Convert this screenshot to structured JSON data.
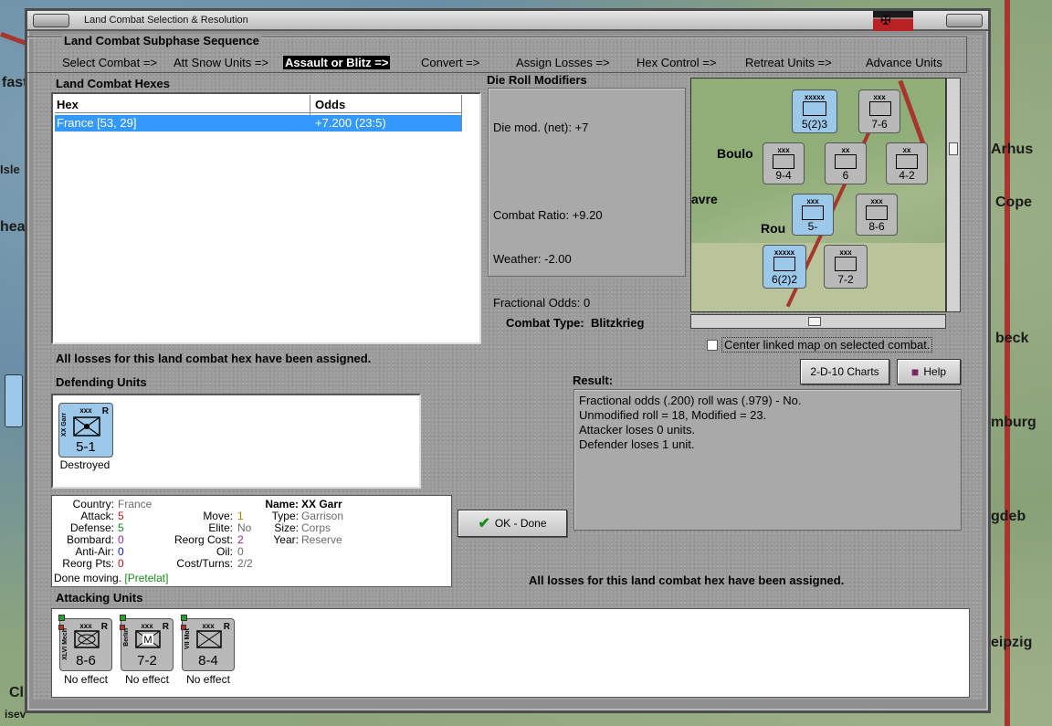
{
  "window": {
    "title": "Land Combat Selection & Resolution"
  },
  "background_map": {
    "labels": [
      "fast",
      "Isle",
      "hea",
      "Arhus",
      "Cope",
      "beck",
      "mburg",
      "gdeb",
      "eipzig",
      "Cl",
      "isev"
    ]
  },
  "subphase": {
    "title": "Land Combat Subphase Sequence",
    "steps": [
      {
        "label": "Select Combat =>",
        "active": false
      },
      {
        "label": "Att Snow Units =>",
        "active": false
      },
      {
        "label": "Assault or Blitz =>",
        "active": true
      },
      {
        "label": "Convert =>",
        "active": false
      },
      {
        "label": "Assign Losses =>",
        "active": false
      },
      {
        "label": "Hex Control =>",
        "active": false
      },
      {
        "label": "Retreat Units =>",
        "active": false
      },
      {
        "label": "Advance Units",
        "active": false
      }
    ]
  },
  "combat_hexes": {
    "title": "Land Combat Hexes",
    "columns": [
      "Hex",
      "Odds"
    ],
    "rows": [
      {
        "hex": "France [53, 29]",
        "odds": "+7.200 (23:5)",
        "selected": true
      }
    ],
    "status": "All losses for this land combat hex have been assigned."
  },
  "die_roll": {
    "title": "Die Roll Modifiers",
    "lines": [
      "Die mod. (net): +7",
      "",
      "Combat Ratio: +9.20",
      "Weather: -2.00",
      "Fractional Odds: 0"
    ]
  },
  "combat_type": {
    "label": "Combat Type:",
    "value": "Blitzkrieg"
  },
  "minimap": {
    "labels": [
      "Boulo",
      "avre",
      "Rou"
    ],
    "counters": [
      {
        "top": "xxxxx",
        "str": "5(2)3",
        "color": "blue"
      },
      {
        "top": "xxx",
        "str": "7-6",
        "color": "grey"
      },
      {
        "top": "xxx",
        "str": "9-4",
        "color": "grey"
      },
      {
        "top": "xx",
        "str": "6",
        "color": "grey"
      },
      {
        "top": "xx",
        "str": "4-2",
        "color": "grey"
      },
      {
        "top": "xxx",
        "str": "5-",
        "color": "blue"
      },
      {
        "top": "xxx",
        "str": "8-6",
        "color": "grey"
      },
      {
        "top": "xxxxx",
        "str": "6(2)2",
        "color": "blue"
      },
      {
        "top": "xxx",
        "str": "7-2",
        "color": "grey"
      }
    ]
  },
  "center_linked": {
    "label": "Center linked map on selected combat."
  },
  "buttons": {
    "charts": "2-D-10 Charts",
    "help": "Help",
    "ok": "OK - Done"
  },
  "defending": {
    "title": "Defending Units",
    "units": [
      {
        "level": "xxx",
        "name": "XX Garr",
        "strength": "5-1",
        "result": "Destroyed"
      }
    ]
  },
  "result": {
    "title": "Result:",
    "lines": [
      "Fractional odds (.200) roll was (.979)  - No.",
      "Unmodified roll = 18, Modified = 23.",
      "Attacker loses 0 units.",
      "Defender loses 1 unit."
    ]
  },
  "unit_info": {
    "left": [
      {
        "label": "Country:",
        "value": "France",
        "color": "#6b6b6b"
      },
      {
        "label": "Attack:",
        "value": "5",
        "color": "#c01818"
      },
      {
        "label": "Defense:",
        "value": "5",
        "color": "#1a8a1a"
      },
      {
        "label": "Bombard:",
        "value": "0",
        "color": "#a020a0"
      },
      {
        "label": "Anti-Air:",
        "value": "0",
        "color": "#1a1acc"
      },
      {
        "label": "Reorg Pts:",
        "value": "0",
        "color": "#c01818"
      }
    ],
    "mid": [
      {
        "label": "Move:",
        "value": "1",
        "color": "#a08800"
      },
      {
        "label": "Elite:",
        "value": "No",
        "color": "#6b6b6b"
      },
      {
        "label": "Reorg Cost:",
        "value": "2",
        "color": "#a020a0"
      },
      {
        "label": "Oil:",
        "value": "0",
        "color": "#6b6b6b"
      },
      {
        "label": "Cost/Turns:",
        "value": "2/2",
        "color": "#6b6b6b"
      }
    ],
    "name_label": "Name:",
    "name": "XX Garr",
    "right": [
      {
        "label": "Type:",
        "value": "Garrison"
      },
      {
        "label": "Size:",
        "value": "Corps"
      },
      {
        "label": "Year:",
        "value": "Reserve"
      }
    ],
    "done_text": "Done moving.",
    "done_location": "[Pretelat]"
  },
  "losses_note": "All losses for this land combat hex have been assigned.",
  "attacking": {
    "title": "Attacking Units",
    "units": [
      {
        "level": "xxx",
        "name": "XLVI Mech",
        "strength": "8-6",
        "result": "No effect",
        "symbol": "x"
      },
      {
        "level": "xxx",
        "name": "Berlin",
        "strength": "7-2",
        "result": "No effect",
        "symbol": "M"
      },
      {
        "level": "xxx",
        "name": "VII Mot",
        "strength": "8-4",
        "result": "No effect",
        "symbol": "x"
      }
    ]
  },
  "colors": {
    "selection": "#3399ff",
    "friendly_counter": "#9cc8ea",
    "enemy_counter": "#b9b9b9",
    "border_red": "#a8352f"
  }
}
